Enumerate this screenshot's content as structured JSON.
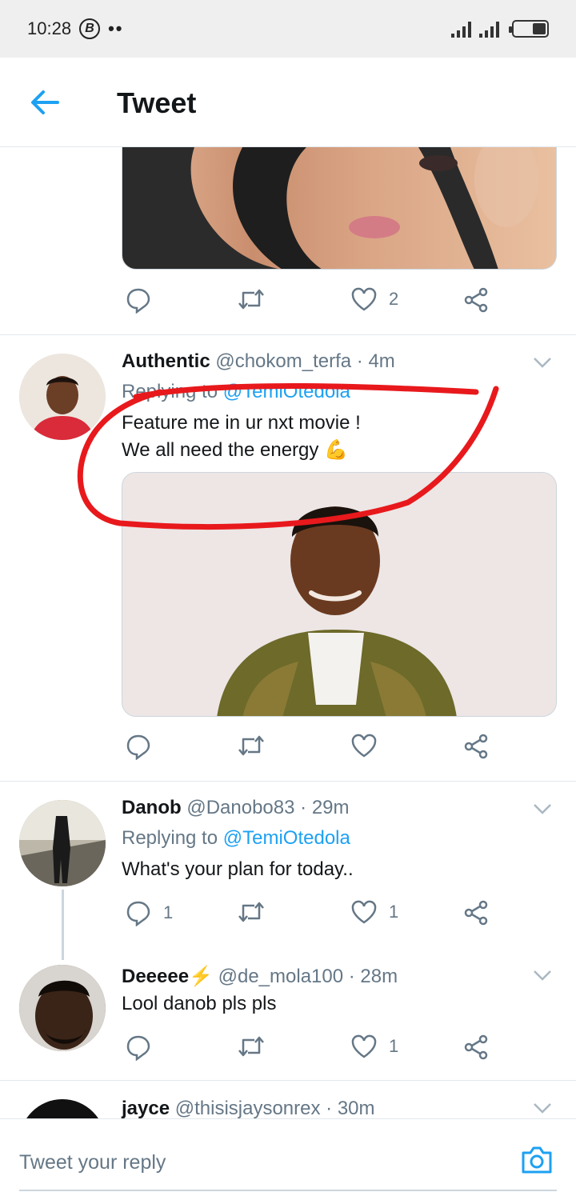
{
  "status_bar": {
    "time": "10:28",
    "badge": "B",
    "dots": "••"
  },
  "header": {
    "title": "Tweet",
    "back_icon": "arrow-left-icon"
  },
  "colors": {
    "accent": "#1da1f2",
    "secondary_text": "#657786",
    "annotation_red": "#e8191c"
  },
  "top_tweet": {
    "likes": "2"
  },
  "tweets": [
    {
      "name": "Authentic",
      "handle": "@chokom_terfa",
      "time": "· 4m",
      "replying_prefix": "Replying to",
      "replying_to": "@TemiOtedola",
      "text_line1": "Feature me in ur nxt movie !",
      "text_line2": "We all need the energy 💪",
      "replies": "",
      "likes": ""
    },
    {
      "name": "Danob",
      "handle": "@Danobo83",
      "time": "· 29m",
      "replying_prefix": "Replying to",
      "replying_to": "@TemiOtedola",
      "text": "What's your plan for today..",
      "replies": "1",
      "likes": "1"
    },
    {
      "name": "Deeeee⚡",
      "handle": "@de_mola100",
      "time": "· 28m",
      "text": "Lool danob pls pls",
      "replies": "",
      "likes": "1"
    },
    {
      "name": "jayce",
      "handle": "@thisisjaysonrex",
      "time": "· 30m"
    }
  ],
  "composer": {
    "placeholder": "Tweet your reply",
    "icon": "camera-icon"
  }
}
